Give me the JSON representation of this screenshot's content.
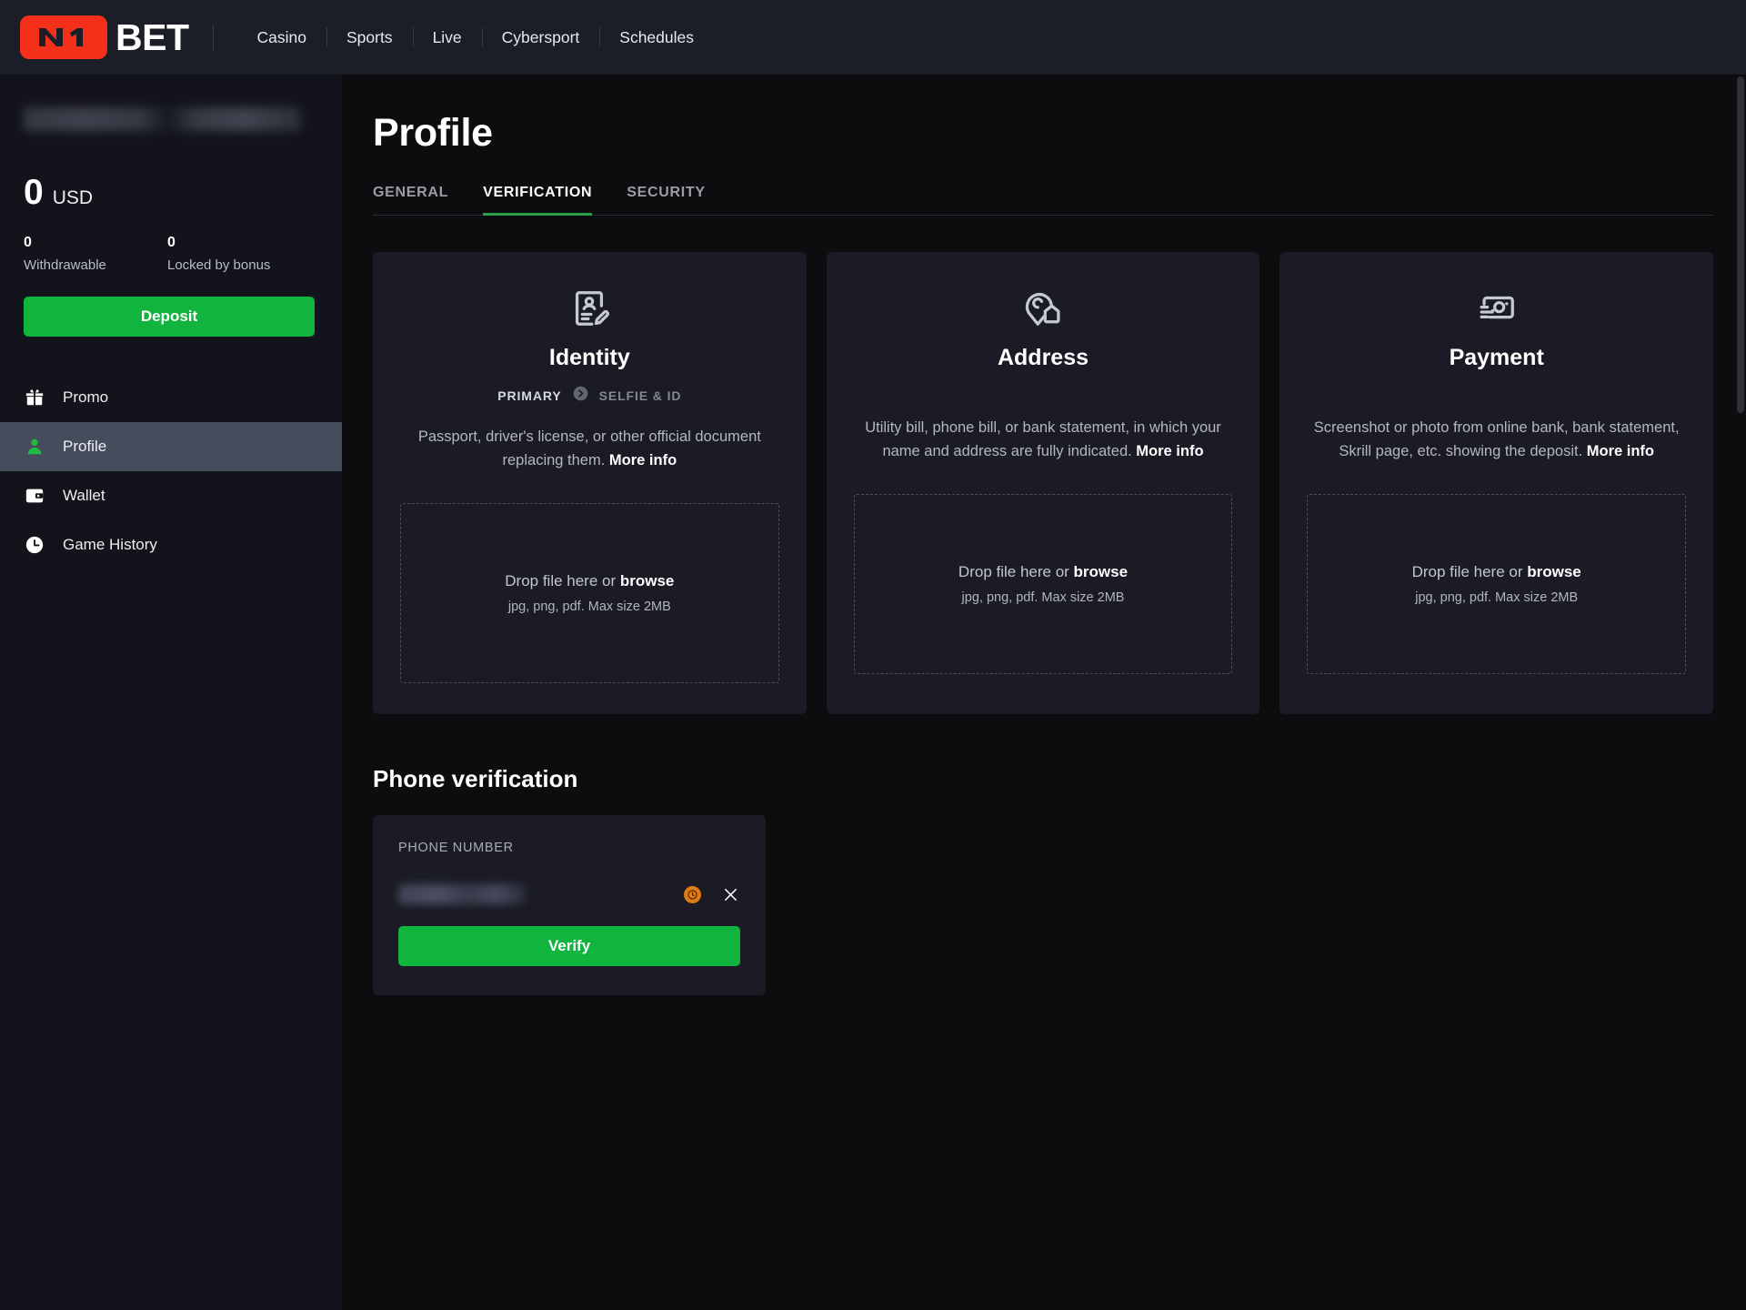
{
  "brand": {
    "mark": "N1",
    "word": "BET",
    "mark_color": "#f5301a"
  },
  "topnav": {
    "items": [
      {
        "label": "Casino"
      },
      {
        "label": "Sports"
      },
      {
        "label": "Live"
      },
      {
        "label": "Cybersport"
      },
      {
        "label": "Schedules"
      }
    ]
  },
  "sidebar": {
    "username_redacted": "",
    "balance": {
      "amount": "0",
      "currency": "USD"
    },
    "sub_balances": [
      {
        "value": "0",
        "label": "Withdrawable"
      },
      {
        "value": "0",
        "label": "Locked by bonus"
      }
    ],
    "deposit_label": "Deposit",
    "menu": [
      {
        "label": "Promo",
        "icon": "gift-icon",
        "active": false
      },
      {
        "label": "Profile",
        "icon": "user-icon",
        "active": true
      },
      {
        "label": "Wallet",
        "icon": "wallet-icon",
        "active": false
      },
      {
        "label": "Game History",
        "icon": "clock-icon",
        "active": false
      }
    ]
  },
  "page": {
    "title": "Profile",
    "tabs": [
      {
        "label": "GENERAL",
        "active": false
      },
      {
        "label": "VERIFICATION",
        "active": true
      },
      {
        "label": "SECURITY",
        "active": false
      }
    ],
    "accent_color": "#2c9d47"
  },
  "verification": {
    "cards": [
      {
        "title": "Identity",
        "icon": "id-card-icon",
        "step_current": "PRIMARY",
        "step_next": "SELFIE & ID",
        "desc_text": "Passport, driver's license, or other official document replacing them. ",
        "desc_link": "More info",
        "drop_text": "Drop file here or ",
        "drop_link": "browse",
        "drop_hint": "jpg, png, pdf. Max size 2MB"
      },
      {
        "title": "Address",
        "icon": "map-pin-house-icon",
        "desc_text": "Utility bill, phone bill, or bank statement, in which your name and address are fully indicated. ",
        "desc_link": "More info",
        "drop_text": "Drop file here or ",
        "drop_link": "browse",
        "drop_hint": "jpg, png, pdf. Max size 2MB"
      },
      {
        "title": "Payment",
        "icon": "banknote-icon",
        "desc_text": "Screenshot or photo from online bank, bank statement, Skrill page, etc. showing the deposit. ",
        "desc_link": "More info",
        "drop_text": "Drop file here or ",
        "drop_link": "browse",
        "drop_hint": "jpg, png, pdf. Max size 2MB"
      }
    ]
  },
  "phone_verification": {
    "heading": "Phone verification",
    "field_label": "PHONE NUMBER",
    "value_redacted": "",
    "status_badge": {
      "name": "pending-clock-badge",
      "color": "#e07b17"
    },
    "remove_icon": "close-icon",
    "verify_label": "Verify"
  }
}
